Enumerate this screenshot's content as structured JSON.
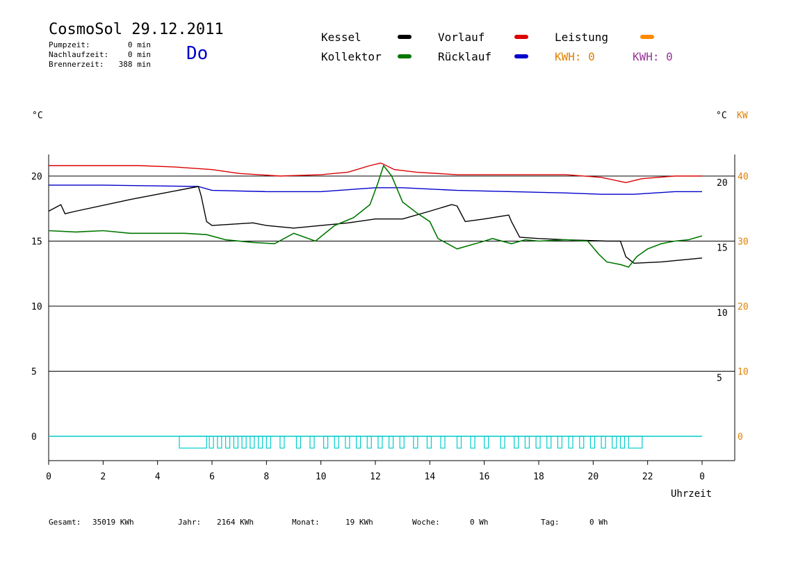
{
  "header": {
    "title": "CosmoSol 29.12.2011",
    "stats": [
      {
        "label": "Pumpzeit:",
        "value": "0 min"
      },
      {
        "label": "Nachlaufzeit:",
        "value": "0 min"
      },
      {
        "label": "Brennerzeit:",
        "value": "388 min"
      }
    ],
    "day": "Do"
  },
  "legend": {
    "kessel": "Kessel",
    "kollektor": "Kollektor",
    "vorlauf": "Vorlauf",
    "ruecklauf": "Rücklauf",
    "leistung": "Leistung",
    "kwh1": "KWH: 0",
    "kwh2": "KWH: 0"
  },
  "colors": {
    "kessel": "#000000",
    "kollektor": "#007700",
    "vorlauf": "#dd0000",
    "ruecklauf": "#0000cc",
    "leistung": "#ff8800",
    "kwh2": "#993399",
    "pump": "#00cccc",
    "orange_axis": "#e08000"
  },
  "footer": {
    "gesamt": {
      "label": "Gesamt:",
      "value": "35019 KWh"
    },
    "jahr": {
      "label": "Jahr:",
      "value": "2164 KWh"
    },
    "monat": {
      "label": "Monat:",
      "value": "19 KWh"
    },
    "woche": {
      "label": "Woche:",
      "value": "0 Wh"
    },
    "tag": {
      "label": "Tag:",
      "value": "0 Wh"
    }
  },
  "chart_data": {
    "type": "line",
    "xlabel": "Uhrzeit",
    "ylabel_left": "°C",
    "ylabel_right_c": "°C",
    "ylabel_right_kw": "KW",
    "xlim": [
      0,
      24
    ],
    "ylim_left": [
      -1.5,
      22
    ],
    "x_ticks": [
      0,
      2,
      4,
      6,
      8,
      10,
      12,
      14,
      16,
      18,
      20,
      22,
      24
    ],
    "x_tick_labels": [
      "0",
      "2",
      "4",
      "6",
      "8",
      "10",
      "12",
      "14",
      "16",
      "18",
      "20",
      "22",
      "0"
    ],
    "left_ticks": [
      0,
      5,
      10,
      15,
      20
    ],
    "right_c_ticks": [
      5,
      10,
      15,
      20
    ],
    "right_kw_ticks": [
      {
        "at": 0,
        "label": "0"
      },
      {
        "at": 5,
        "label": "10"
      },
      {
        "at": 10,
        "label": "20"
      },
      {
        "at": 15,
        "label": "30"
      },
      {
        "at": 20,
        "label": "40"
      }
    ],
    "grid_lines": [
      0,
      5,
      10,
      15,
      20
    ],
    "series": [
      {
        "key": "vorlauf",
        "name": "Vorlauf",
        "x": [
          0,
          3.3,
          4.6,
          6,
          7,
          8.5,
          10,
          11,
          11.8,
          12.2,
          12.4,
          12.7,
          13.5,
          15,
          17,
          19,
          20.3,
          21.2,
          21.8,
          23,
          24
        ],
        "y": [
          20.8,
          20.8,
          20.7,
          20.5,
          20.2,
          20.0,
          20.1,
          20.3,
          20.8,
          21.0,
          20.8,
          20.5,
          20.3,
          20.1,
          20.1,
          20.1,
          19.9,
          19.5,
          19.8,
          20.0,
          20.0
        ]
      },
      {
        "key": "ruecklauf",
        "name": "Rücklauf",
        "x": [
          0,
          2,
          5.5,
          6,
          8,
          10,
          12,
          13,
          15,
          17,
          19,
          20.3,
          21.5,
          23,
          24
        ],
        "y": [
          19.3,
          19.3,
          19.2,
          18.9,
          18.8,
          18.8,
          19.1,
          19.1,
          18.9,
          18.8,
          18.7,
          18.6,
          18.6,
          18.8,
          18.8
        ]
      },
      {
        "key": "kessel",
        "name": "Kessel",
        "x": [
          0,
          0.45,
          0.6,
          1,
          3,
          4,
          5.5,
          5.6,
          5.8,
          6,
          7.5,
          8,
          8.5,
          9,
          10,
          11,
          12,
          13,
          14,
          14.8,
          15,
          15.3,
          16,
          16.9,
          17,
          17.3,
          18,
          19,
          20.5,
          21,
          21.2,
          21.5,
          22.5,
          24
        ],
        "y": [
          17.3,
          17.8,
          17.1,
          17.3,
          18.2,
          18.6,
          19.2,
          18.5,
          16.5,
          16.2,
          16.4,
          16.2,
          16.1,
          16.0,
          16.2,
          16.4,
          16.7,
          16.7,
          17.3,
          17.8,
          17.7,
          16.5,
          16.7,
          17.0,
          16.5,
          15.3,
          15.2,
          15.1,
          15.0,
          15.0,
          13.8,
          13.3,
          13.4,
          13.7
        ]
      },
      {
        "key": "kollektor",
        "name": "Kollektor",
        "x": [
          0,
          1,
          2,
          3,
          4,
          5,
          5.8,
          6.5,
          7.5,
          8.3,
          9,
          9.8,
          10.5,
          11.2,
          11.8,
          12.1,
          12.3,
          12.6,
          13,
          13.5,
          14,
          14.3,
          15,
          15.5,
          16,
          16.3,
          17,
          17.5,
          18,
          19,
          19.8,
          20.2,
          20.5,
          21,
          21.3,
          21.6,
          22,
          22.5,
          23,
          23.5,
          24
        ],
        "y": [
          15.8,
          15.7,
          15.8,
          15.6,
          15.6,
          15.6,
          15.5,
          15.1,
          14.9,
          14.8,
          15.6,
          15.0,
          16.2,
          16.8,
          17.8,
          19.5,
          20.8,
          20.0,
          18.0,
          17.2,
          16.5,
          15.2,
          14.4,
          14.7,
          15.0,
          15.2,
          14.8,
          15.1,
          15.0,
          15.1,
          15.0,
          14.0,
          13.4,
          13.2,
          13.0,
          13.8,
          14.4,
          14.8,
          15.0,
          15.1,
          15.4
        ]
      }
    ],
    "pump_baseline_y": 0,
    "pump_pulses": [
      4.8,
      5.9,
      6.2,
      6.5,
      6.8,
      7.1,
      7.4,
      7.7,
      8.0,
      8.5,
      9.1,
      9.6,
      10.1,
      10.5,
      10.9,
      11.3,
      11.7,
      12.1,
      12.5,
      12.9,
      13.4,
      13.9,
      14.4,
      15.0,
      15.5,
      16.0,
      16.6,
      17.1,
      17.5,
      17.9,
      18.3,
      18.7,
      19.1,
      19.5,
      19.9,
      20.3,
      20.7,
      21.0,
      21.3
    ]
  }
}
